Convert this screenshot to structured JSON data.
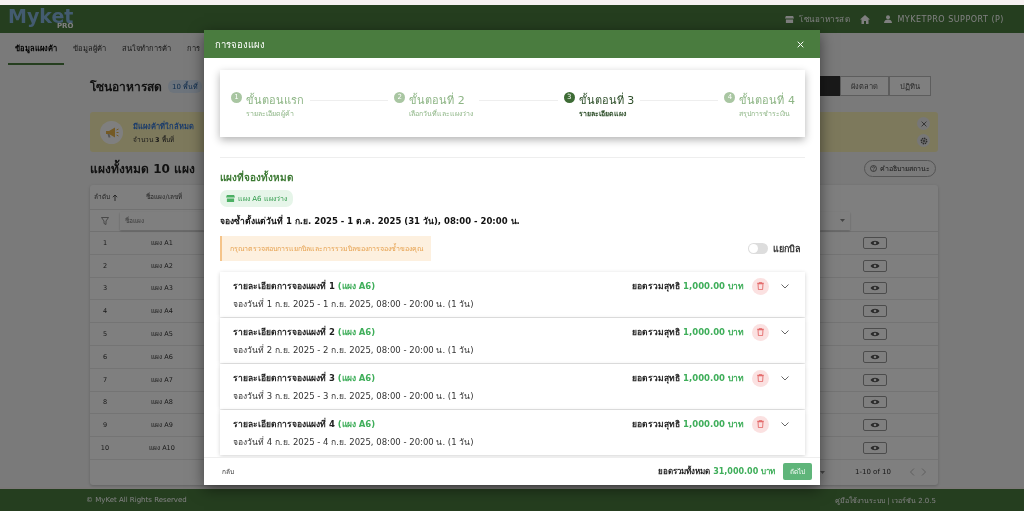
{
  "header": {
    "logo": "Myket",
    "logo_sub": "PRO",
    "zone": "โซนอาหารสด",
    "user": "MYKETPRO SUPPORT (P)"
  },
  "tabs": [
    {
      "label": "ข้อมูลแผงค้า",
      "selected": true
    },
    {
      "label": "ข้อมูลผู้ค้า",
      "selected": false
    },
    {
      "label": "สนใจทำการค้า",
      "selected": false
    },
    {
      "label": "การ",
      "selected": false
    }
  ],
  "page": {
    "title": "โซนอาหารสด",
    "badge": "10 พื้นที่",
    "view_buttons": [
      {
        "selected": true
      },
      {
        "label": "ผังตลาด",
        "selected": false
      },
      {
        "label": "ปฏิทิน",
        "selected": false
      }
    ]
  },
  "banner": {
    "title": "มีแผงค้าที่ใกล้หมด",
    "text": "จำนวน **3** พื้นที่"
  },
  "table": {
    "heading": "แผงทั้งหมด 10 แผง",
    "status_help": "คำอธิบายสถานะ",
    "columns": [
      "ลำดับ",
      "ชื่อแผง/เลขที่"
    ],
    "filter_placeholder": "ชื่อแผง",
    "rows": [
      {
        "no": "1",
        "name": "แผง A1"
      },
      {
        "no": "2",
        "name": "แผง A2"
      },
      {
        "no": "3",
        "name": "แผง A3"
      },
      {
        "no": "4",
        "name": "แผง A4"
      },
      {
        "no": "5",
        "name": "แผง A5"
      },
      {
        "no": "6",
        "name": "แผง A6"
      },
      {
        "no": "7",
        "name": "แผง A7"
      },
      {
        "no": "8",
        "name": "แผง A8"
      },
      {
        "no": "9",
        "name": "แผง A9"
      },
      {
        "no": "10",
        "name": "แผง A10"
      }
    ],
    "pagination": "1-10 of 10"
  },
  "footer": {
    "copyright": "© MyKet All Rights Reserved",
    "links": "คู่มือใช้งานระบบ | เวอร์ชัน 2.0.5"
  },
  "modal": {
    "title": "การจองแผง",
    "steps": [
      {
        "number": "1",
        "title": "ขั้นตอนแรก",
        "subtitle": "รายละเอียดผู้ค้า",
        "selected": false
      },
      {
        "number": "2",
        "title": "ขั้นตอนที่ 2",
        "subtitle": "เลือกวันที่และแผงว่าง",
        "selected": false
      },
      {
        "number": "3",
        "title": "ขั้นตอนที่ 3",
        "subtitle": "รายละเอียดแผง",
        "selected": true
      },
      {
        "number": "4",
        "title": "ขั้นตอนที่ 4",
        "subtitle": "สรุปการชำระเงิน",
        "selected": false
      }
    ],
    "section_title": "แผงที่จองทั้งหมด",
    "chip": "แผง A6 แผงว่าง",
    "repeat_text": "จองซ้ำตั้งแต่วันที่ 1 ก.ย. 2025 - 1 ต.ค. 2025 (31 วัน), 08:00 - 20:00 น.",
    "notice": "กรุณาตรวจสอบการแยกบิลและการรวมบิลของการจองซ้ำของคุณ",
    "split_bill": {
      "label": "แยกบิล",
      "on": false
    },
    "bookings": [
      {
        "title": "รายละเอียดการจองแผงที่ 1",
        "stall": "(แผง A6)",
        "total_label": "ยอดรวมสุทธิ",
        "total": "1,000.00 บาท",
        "dates": "จองวันที่ 1 ก.ย. 2025 - 1 ก.ย. 2025, 08:00 - 20:00 น. (1 วัน)"
      },
      {
        "title": "รายละเอียดการจองแผงที่ 2",
        "stall": "(แผง A6)",
        "total_label": "ยอดรวมสุทธิ",
        "total": "1,000.00 บาท",
        "dates": "จองวันที่ 2 ก.ย. 2025 - 2 ก.ย. 2025, 08:00 - 20:00 น. (1 วัน)"
      },
      {
        "title": "รายละเอียดการจองแผงที่ 3",
        "stall": "(แผง A6)",
        "total_label": "ยอดรวมสุทธิ",
        "total": "1,000.00 บาท",
        "dates": "จองวันที่ 3 ก.ย. 2025 - 3 ก.ย. 2025, 08:00 - 20:00 น. (1 วัน)"
      },
      {
        "title": "รายละเอียดการจองแผงที่ 4",
        "stall": "(แผง A6)",
        "total_label": "ยอดรวมสุทธิ",
        "total": "1,000.00 บาท",
        "dates": "จองวันที่ 4 ก.ย. 2025 - 4 ก.ย. 2025, 08:00 - 20:00 น. (1 วัน)"
      }
    ],
    "back": "กลับ",
    "grand_total_label": "ยอดรวมทั้งหมด",
    "grand_total": "31,000.00 บาท",
    "next": "ถัดไป"
  }
}
